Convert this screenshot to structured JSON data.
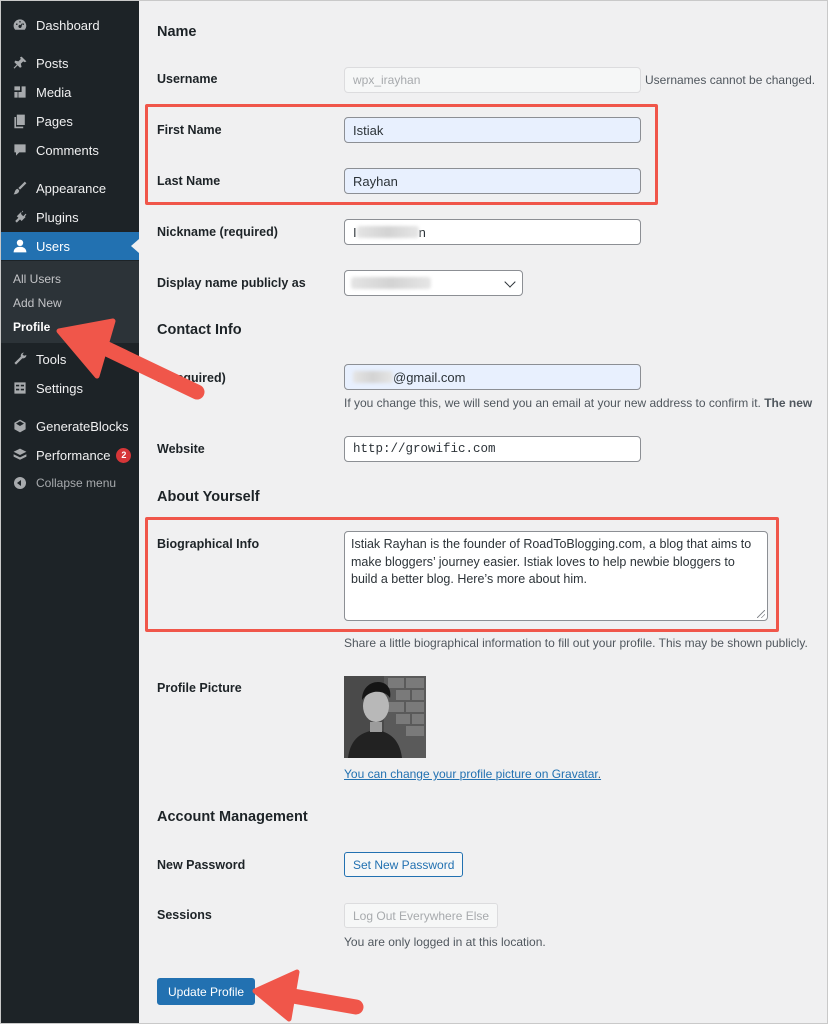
{
  "sidebar": {
    "menu": [
      {
        "label": "Dashboard",
        "icon": "dashboard-icon"
      },
      {
        "label": "Posts",
        "icon": "pin-icon"
      },
      {
        "label": "Media",
        "icon": "media-icon"
      },
      {
        "label": "Pages",
        "icon": "pages-icon"
      },
      {
        "label": "Comments",
        "icon": "comment-icon"
      },
      {
        "label": "Appearance",
        "icon": "paintbrush-icon"
      },
      {
        "label": "Plugins",
        "icon": "plugin-icon"
      },
      {
        "label": "Users",
        "icon": "user-icon"
      },
      {
        "label": "Tools",
        "icon": "wrench-icon"
      },
      {
        "label": "Settings",
        "icon": "settings-icon"
      },
      {
        "label": "GenerateBlocks",
        "icon": "cube-icon"
      },
      {
        "label": "Performance",
        "icon": "performance-icon",
        "badge": "2"
      },
      {
        "label": "Collapse menu",
        "icon": "collapse-icon"
      }
    ],
    "submenu": [
      {
        "label": "All Users"
      },
      {
        "label": "Add New"
      },
      {
        "label": "Profile"
      }
    ]
  },
  "sections": {
    "name": "Name",
    "contact": "Contact Info",
    "about": "About Yourself",
    "account": "Account Management"
  },
  "fields": {
    "username": {
      "label": "Username",
      "value": "wpx_irayhan",
      "hint": "Usernames cannot be changed."
    },
    "first_name": {
      "label": "First Name",
      "value": "Istiak"
    },
    "last_name": {
      "label": "Last Name",
      "value": "Rayhan"
    },
    "nickname": {
      "label": "Nickname (required)",
      "value_prefix": "I",
      "value_suffix": "n"
    },
    "display_name": {
      "label": "Display name publicly as"
    },
    "email": {
      "label": "il (required)",
      "value_suffix": "@gmail.com",
      "hint": "If you change this, we will send you an email at your new address to confirm it.",
      "hint_bold": "The new"
    },
    "website": {
      "label": "Website",
      "value": "http://growific.com"
    },
    "bio": {
      "label": "Biographical Info",
      "value": "Istiak Rayhan is the founder of RoadToBlogging.com, a blog that aims to make bloggers’ journey easier. Istiak loves to help newbie bloggers to build a better blog. Here’s more about him.",
      "hint": "Share a little biographical information to fill out your profile. This may be shown publicly."
    },
    "profile_picture": {
      "label": "Profile Picture",
      "link": "You can change your profile picture on Gravatar",
      "link_suffix": "."
    },
    "new_password": {
      "label": "New Password",
      "button": "Set New Password"
    },
    "sessions": {
      "label": "Sessions",
      "button": "Log Out Everywhere Else",
      "hint": "You are only logged in at this location."
    }
  },
  "update_button": "Update Profile",
  "colors": {
    "sidebar_bg": "#1d2327",
    "accent": "#2271b1",
    "highlight": "#f0564a",
    "badge": "#d63638"
  }
}
